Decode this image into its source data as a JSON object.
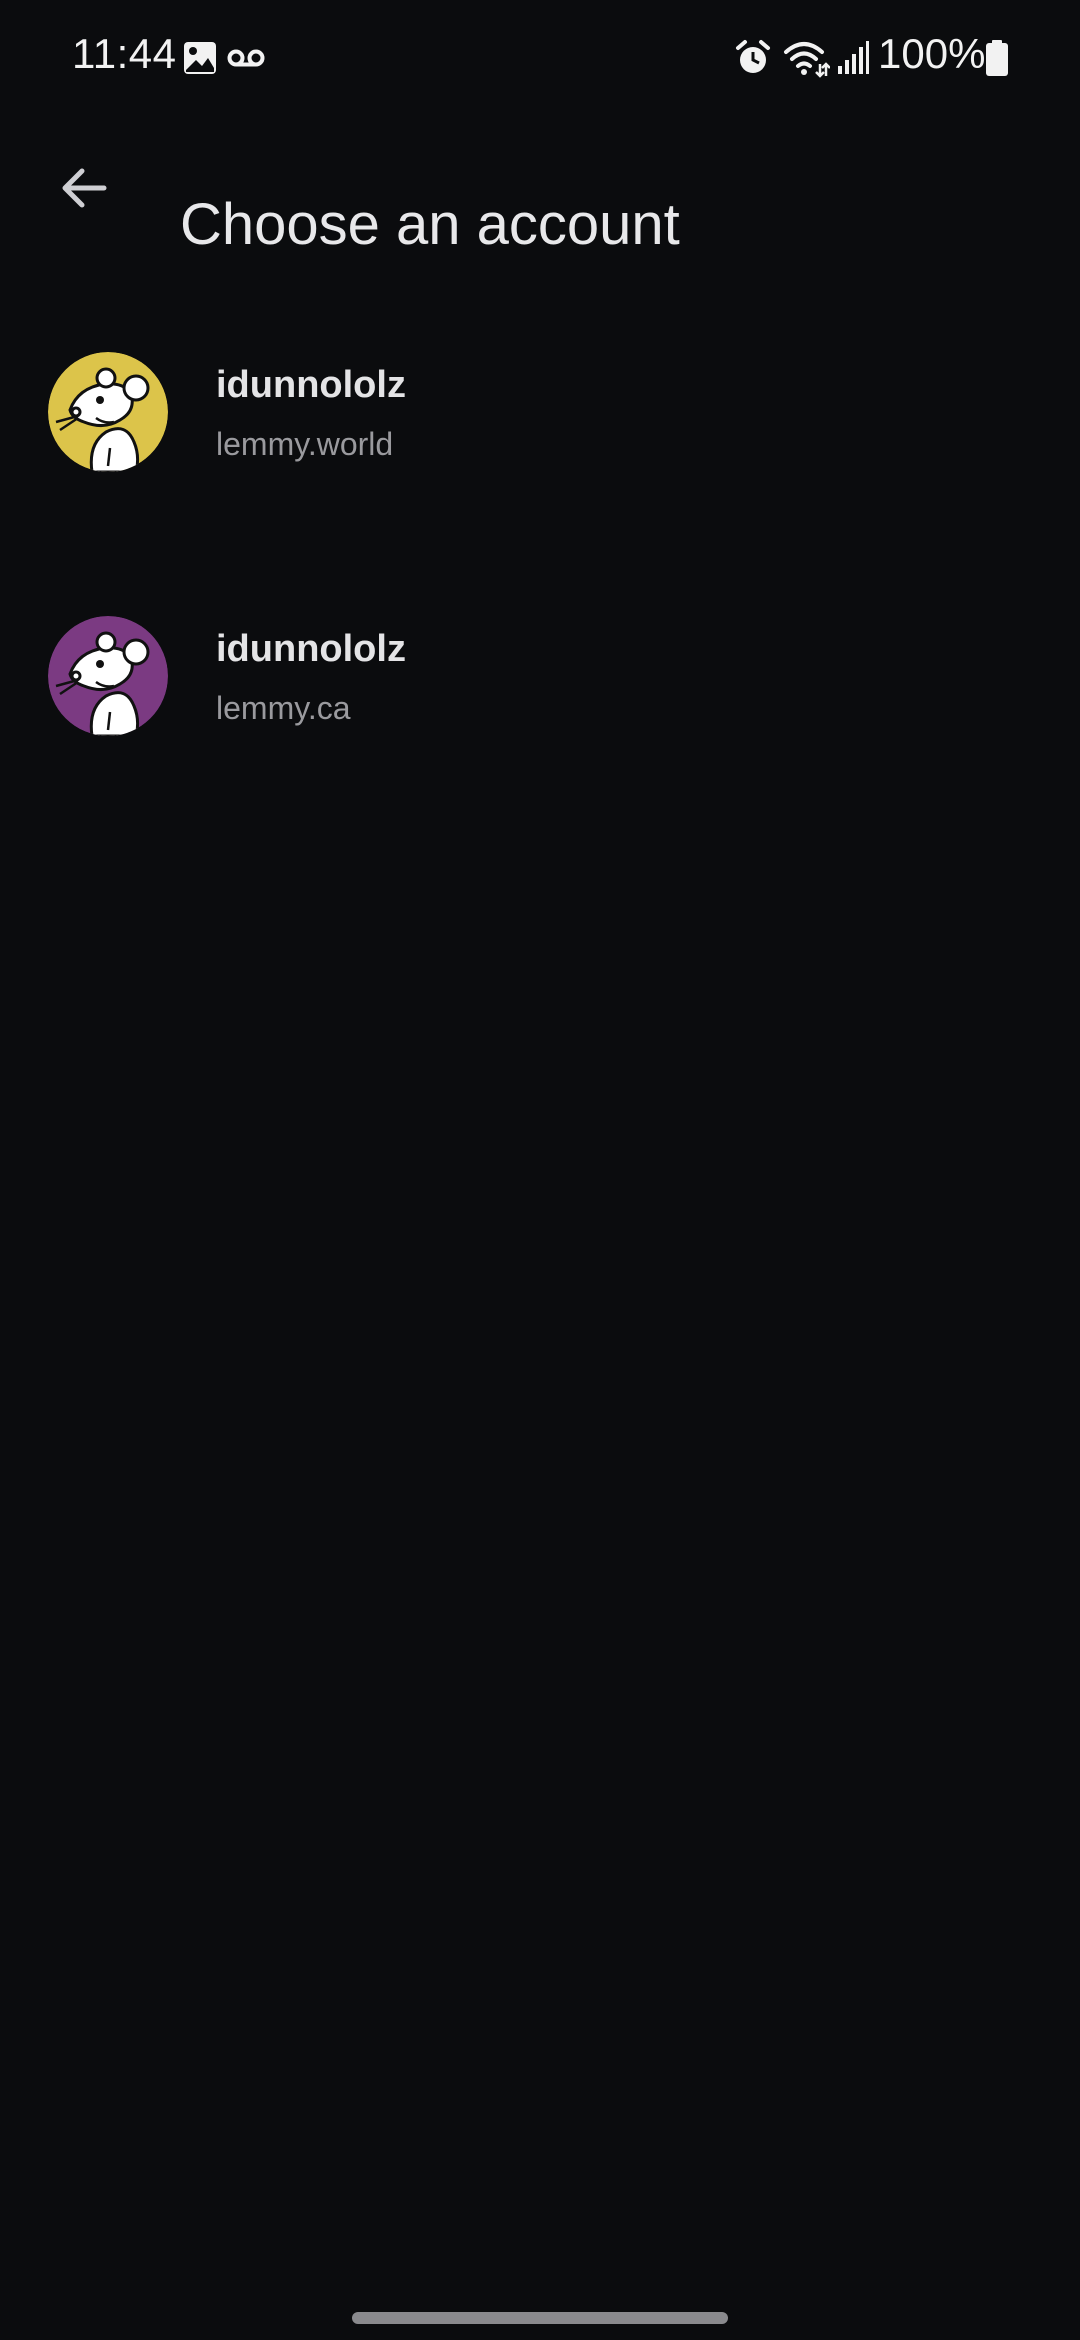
{
  "status_bar": {
    "time": "11:44",
    "battery_percent": "100%",
    "icons": [
      "gallery-icon",
      "voicemail-icon",
      "alarm-icon",
      "wifi-icon",
      "signal-icon",
      "battery-icon"
    ]
  },
  "app_bar": {
    "back_icon": "arrow-back-icon",
    "title": "Choose an account"
  },
  "accounts": [
    {
      "name": "idunnololz",
      "instance": "lemmy.world",
      "avatar_color": "#dcc44a"
    },
    {
      "name": "idunnololz",
      "instance": "lemmy.ca",
      "avatar_color": "#7b3a82"
    }
  ],
  "colors": {
    "background": "#0b0c0e",
    "title_text": "#e8e8ea",
    "secondary_text": "#9a9a9e"
  }
}
